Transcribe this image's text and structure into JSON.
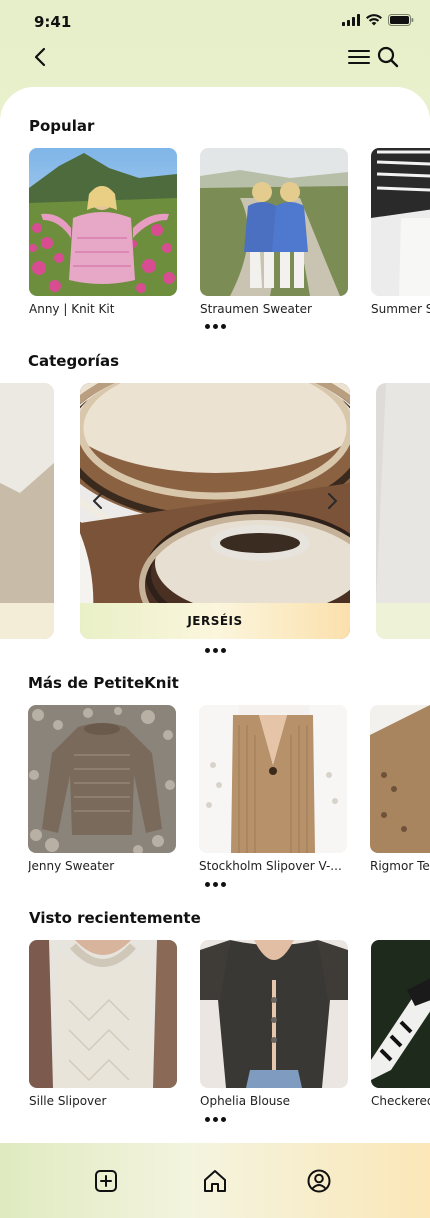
{
  "status": {
    "time": "9:41"
  },
  "nav": {
    "back": "back-icon",
    "menu": "menu-icon",
    "search": "search-icon"
  },
  "popular": {
    "title": "Popular",
    "items": [
      {
        "label": "Anny | Knit Kit"
      },
      {
        "label": "Straumen Sweater"
      },
      {
        "label": "Summer S"
      }
    ]
  },
  "categories": {
    "title": "Categorías",
    "active_label": "JERSÉIS"
  },
  "more": {
    "title": "Más de PetiteKnit",
    "items": [
      {
        "label": "Jenny Sweater"
      },
      {
        "label": "Stockholm Slipover V-..."
      },
      {
        "label": "Rigmor Te"
      }
    ]
  },
  "recent": {
    "title": "Visto recientemente",
    "items": [
      {
        "label": "Sille Slipover"
      },
      {
        "label": "Ophelia Blouse"
      },
      {
        "label": "Checkered"
      }
    ]
  },
  "tabbar": {
    "add": "add-square-icon",
    "home": "home-icon",
    "profile": "profile-icon"
  },
  "colors": {
    "accent": "#111111",
    "gradient_start": "#dfeac0",
    "gradient_end": "#fbe7b8"
  }
}
